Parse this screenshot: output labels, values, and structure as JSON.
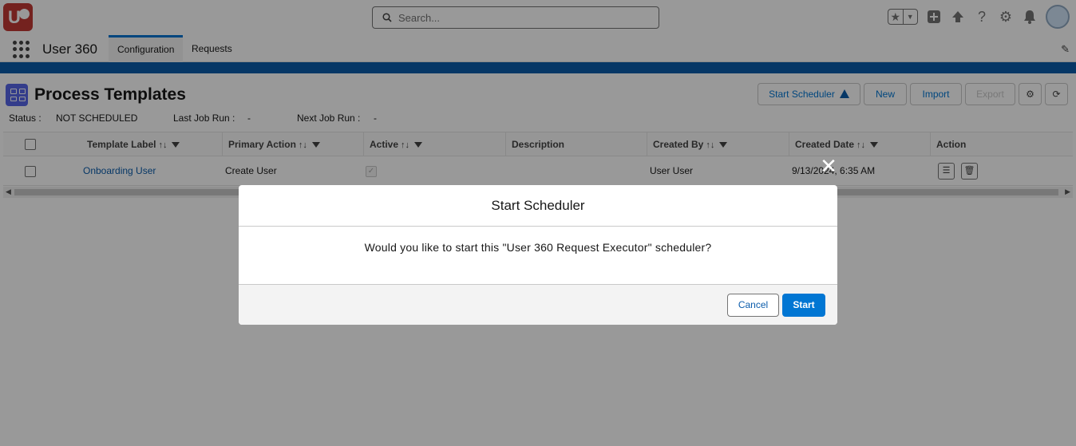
{
  "header": {
    "search_placeholder": "Search..."
  },
  "nav": {
    "app_name": "User 360",
    "tabs": [
      {
        "label": "Configuration",
        "active": true
      },
      {
        "label": "Requests",
        "active": false
      }
    ]
  },
  "card": {
    "title": "Process Templates",
    "status_label": "Status :",
    "status_value": "NOT SCHEDULED",
    "last_run_label": "Last Job Run :",
    "last_run_value": "-",
    "next_run_label": "Next Job Run :",
    "next_run_value": "-",
    "buttons": {
      "start_scheduler": "Start Scheduler",
      "new": "New",
      "import": "Import",
      "export": "Export"
    }
  },
  "table": {
    "columns": [
      "Template Label",
      "Primary Action",
      "Active",
      "Description",
      "Created By",
      "Created Date",
      "Action"
    ],
    "rows": [
      {
        "template_label": "Onboarding User",
        "primary_action": "Create User",
        "active": true,
        "description": "",
        "created_by": "User User",
        "created_date": "9/13/2024, 6:35 AM"
      }
    ]
  },
  "modal": {
    "title": "Start Scheduler",
    "message": "Would you like to start this \"User 360 Request Executor\" scheduler?",
    "cancel_label": "Cancel",
    "start_label": "Start"
  },
  "colors": {
    "brand_blue": "#0176d3",
    "logo_red": "#c23934",
    "band": "#0b5cab"
  }
}
